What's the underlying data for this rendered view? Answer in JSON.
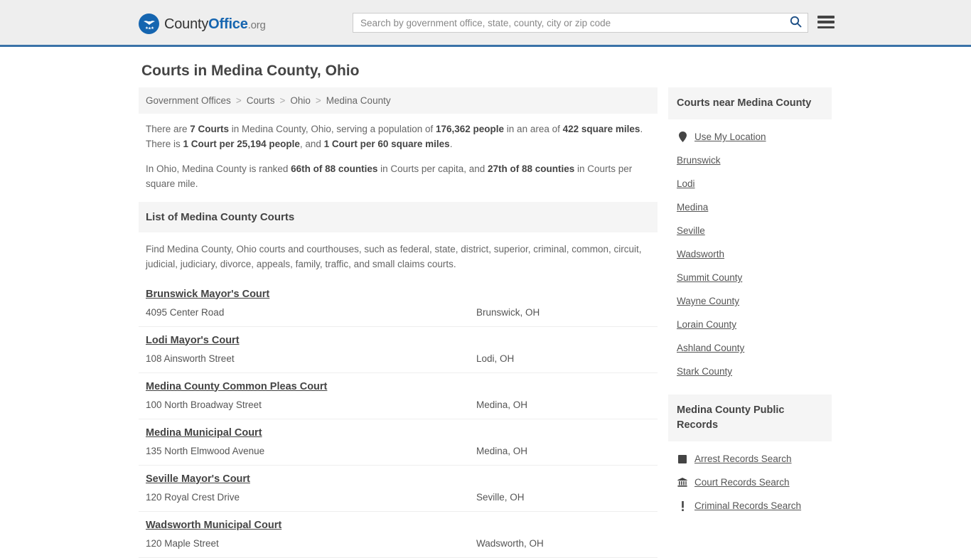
{
  "header": {
    "logo": {
      "part1": "County",
      "part2": "Office",
      "part3": ".org",
      "icon": "eagle-seal-icon"
    },
    "search": {
      "placeholder": "Search by government office, state, county, city or zip code",
      "value": ""
    },
    "search_icon": "search-icon",
    "menu_icon": "hamburger-menu-icon",
    "accent_color": "#3a72a8"
  },
  "page": {
    "title": "Courts in Medina County, Ohio"
  },
  "breadcrumb": {
    "items": [
      {
        "label": "Government Offices"
      },
      {
        "label": "Courts"
      },
      {
        "label": "Ohio"
      },
      {
        "label": "Medina County"
      }
    ],
    "separator": ">"
  },
  "stats": {
    "para1": {
      "t1": "There are ",
      "b1": "7 Courts",
      "t2": " in Medina County, Ohio, serving a population of ",
      "b2": "176,362 people",
      "t3": " in an area of ",
      "b3": "422 square miles",
      "t4": ". There is ",
      "b4": "1 Court per 25,194 people",
      "t5": ", and ",
      "b5": "1 Court per 60 square miles",
      "t6": "."
    },
    "para2": {
      "t1": "In Ohio, Medina County is ranked ",
      "b1": "66th of 88 counties",
      "t2": " in Courts per capita, and ",
      "b2": "27th of 88 counties",
      "t3": " in Courts per square mile."
    }
  },
  "list_section": {
    "heading": "List of Medina County Courts",
    "description": "Find Medina County, Ohio courts and courthouses, such as federal, state, district, superior, criminal, common, circuit, judicial, judiciary, divorce, appeals, family, traffic, and small claims courts."
  },
  "courts": [
    {
      "name": "Brunswick Mayor's Court",
      "address": "4095 Center Road",
      "city": "Brunswick, OH"
    },
    {
      "name": "Lodi Mayor's Court",
      "address": "108 Ainsworth Street",
      "city": "Lodi, OH"
    },
    {
      "name": "Medina County Common Pleas Court",
      "address": "100 North Broadway Street",
      "city": "Medina, OH"
    },
    {
      "name": "Medina Municipal Court",
      "address": "135 North Elmwood Avenue",
      "city": "Medina, OH"
    },
    {
      "name": "Seville Mayor's Court",
      "address": "120 Royal Crest Drive",
      "city": "Seville, OH"
    },
    {
      "name": "Wadsworth Municipal Court",
      "address": "120 Maple Street",
      "city": "Wadsworth, OH"
    }
  ],
  "sidebar": {
    "nearby": {
      "heading": "Courts near Medina County",
      "items": [
        {
          "label": "Use My Location",
          "icon": "map-pin-icon"
        },
        {
          "label": "Brunswick",
          "icon": ""
        },
        {
          "label": "Lodi",
          "icon": ""
        },
        {
          "label": "Medina",
          "icon": ""
        },
        {
          "label": "Seville",
          "icon": ""
        },
        {
          "label": "Wadsworth",
          "icon": ""
        },
        {
          "label": "Summit County",
          "icon": ""
        },
        {
          "label": "Wayne County",
          "icon": ""
        },
        {
          "label": "Lorain County",
          "icon": ""
        },
        {
          "label": "Ashland County",
          "icon": ""
        },
        {
          "label": "Stark County",
          "icon": ""
        }
      ]
    },
    "public_records": {
      "heading": "Medina County Public Records",
      "items": [
        {
          "label": "Arrest Records Search",
          "icon": "fingerprint-icon"
        },
        {
          "label": "Court Records Search",
          "icon": "courthouse-icon"
        },
        {
          "label": "Criminal Records Search",
          "icon": "exclamation-icon"
        }
      ]
    }
  }
}
